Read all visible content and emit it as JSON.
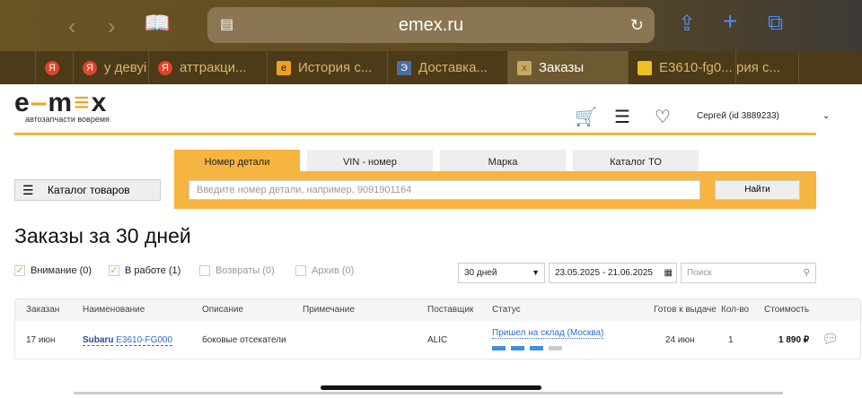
{
  "browser": {
    "url": "emex.ru",
    "tabs": [
      {
        "label": "",
        "icon": "Я"
      },
      {
        "label": "у девуі",
        "icon": "Я"
      },
      {
        "label": "аттракци...",
        "icon": "Я"
      },
      {
        "label": "История с...",
        "icon": "e"
      },
      {
        "label": "Доставка...",
        "icon": "Э"
      },
      {
        "label": "Заказы",
        "icon": "x"
      },
      {
        "label": "E3610-fg0...",
        "icon": "img"
      },
      {
        "label": "рия с...",
        "icon": ""
      }
    ]
  },
  "header": {
    "logo": "emex",
    "tagline": "автозапчасти вовремя",
    "user": "Сергей",
    "user_id": "(id 3889233)"
  },
  "search": {
    "tabs": [
      "Номер детали",
      "VIN - номер",
      "Марка",
      "Каталог ТО"
    ],
    "placeholder": "Введите номер детали, например, 9091901164",
    "button": "Найти",
    "catalog": "Каталог товаров"
  },
  "page": {
    "title": "Заказы за 30 дней",
    "filters": [
      {
        "label": "Внимание (0)",
        "checked": true
      },
      {
        "label": "В работе (1)",
        "checked": true
      },
      {
        "label": "Возвраты (0)",
        "checked": false
      },
      {
        "label": "Архив (0)",
        "checked": false
      }
    ],
    "period": "30 дней",
    "date_range": "23.05.2025 - 21.06.2025",
    "search_placeholder": "Поиск"
  },
  "table": {
    "headers": [
      "Заказан",
      "Наименование",
      "Описание",
      "Примечание",
      "Поставщик",
      "Статус",
      "Готов к выдаче",
      "Кол-во",
      "Стоимость"
    ],
    "rows": [
      {
        "ordered": "17 июн",
        "brand": "Subaru",
        "part": "E3610-FG000",
        "description": "боковые отсекатели",
        "note": "",
        "supplier": "ALIC",
        "status": "Пришел на склад (Москва)",
        "status_steps_done": 3,
        "status_steps_total": 4,
        "ready": "24 июн",
        "qty": "1",
        "price": "1 890 ₽"
      }
    ]
  }
}
